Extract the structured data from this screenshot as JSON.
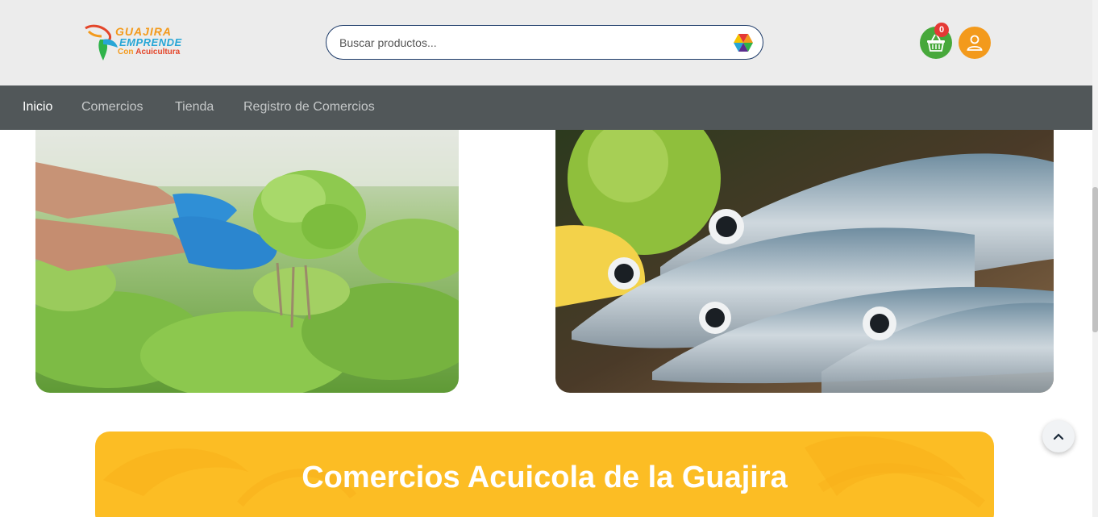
{
  "header": {
    "logo": {
      "line1": "GUAJIRA",
      "line2": "EMPRENDE",
      "line3_prefix": "Con",
      "line3_accent": "Acuicultura"
    },
    "search": {
      "placeholder": "Buscar productos...",
      "value": ""
    },
    "cart": {
      "count": "0",
      "icon": "basket-icon"
    },
    "user": {
      "icon": "user-icon"
    }
  },
  "nav": {
    "items": [
      {
        "label": "Inicio",
        "active": true
      },
      {
        "label": "Comercios",
        "active": false
      },
      {
        "label": "Tienda",
        "active": false
      },
      {
        "label": "Registro de Comercios",
        "active": false
      }
    ]
  },
  "gallery": [
    {
      "subject": "hydroponic-lettuce-image"
    },
    {
      "subject": "fresh-fish-image"
    }
  ],
  "banner": {
    "title": "Comercios Acuicola de la Guajira"
  },
  "colors": {
    "header_bg": "#ececec",
    "nav_bg": "#515759",
    "brand_orange": "#f39a1c",
    "brand_blue": "#27a6d6",
    "cart_green": "#47a83b",
    "banner_yellow": "#fcbd24"
  }
}
